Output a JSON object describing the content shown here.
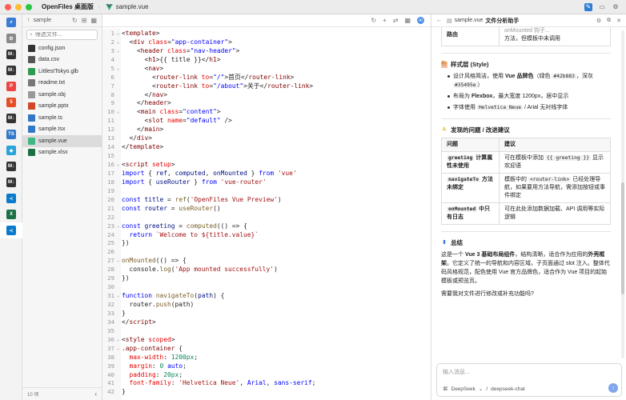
{
  "titlebar": {
    "app_name": "OpenFiles 桌面版",
    "separator": "·",
    "file_name": "sample.vue"
  },
  "sidebar": {
    "folder": "sample",
    "search_placeholder": "筛选文件...",
    "files": [
      {
        "name": "config.json",
        "icon": "github-icon",
        "color": "#333333"
      },
      {
        "name": "data.csv",
        "icon": "csv-icon",
        "color": "#555555"
      },
      {
        "name": "LittlestTokyo.glb",
        "icon": "3d-model-icon",
        "color": "#2e9b4e"
      },
      {
        "name": "readme.txt",
        "icon": "text-file-icon",
        "color": "#777777"
      },
      {
        "name": "sample.obj",
        "icon": "object-file-icon",
        "color": "#999999"
      },
      {
        "name": "sample.pptx",
        "icon": "powerpoint-icon",
        "color": "#d24726"
      },
      {
        "name": "sample.ts",
        "icon": "typescript-icon",
        "color": "#3178c6"
      },
      {
        "name": "sample.tsx",
        "icon": "typescript-icon",
        "color": "#3178c6"
      },
      {
        "name": "sample.vue",
        "icon": "vue-icon",
        "color": "#41b883",
        "selected": true
      },
      {
        "name": "sample.xlsx",
        "icon": "excel-icon",
        "color": "#1d7044"
      }
    ],
    "footer_count": "10 项"
  },
  "editor": {
    "lines": [
      [
        [
          "c-plain",
          "<"
        ],
        [
          "c-tag",
          "template"
        ],
        [
          "c-plain",
          ">"
        ]
      ],
      [
        [
          "c-plain",
          "  <"
        ],
        [
          "c-tag",
          "div"
        ],
        [
          "c-plain",
          " "
        ],
        [
          "c-attr",
          "class"
        ],
        [
          "c-plain",
          "="
        ],
        [
          "c-str",
          "\"app-container\""
        ],
        [
          "c-plain",
          ">"
        ]
      ],
      [
        [
          "c-plain",
          "    <"
        ],
        [
          "c-tag",
          "header"
        ],
        [
          "c-plain",
          " "
        ],
        [
          "c-attr",
          "class"
        ],
        [
          "c-plain",
          "="
        ],
        [
          "c-str",
          "\"nav-header\""
        ],
        [
          "c-plain",
          ">"
        ]
      ],
      [
        [
          "c-plain",
          "      <"
        ],
        [
          "c-tag",
          "h1"
        ],
        [
          "c-plain",
          ">{{ title }}</"
        ],
        [
          "c-tag",
          "h1"
        ],
        [
          "c-plain",
          ">"
        ]
      ],
      [
        [
          "c-plain",
          "      <"
        ],
        [
          "c-tag",
          "nav"
        ],
        [
          "c-plain",
          ">"
        ]
      ],
      [
        [
          "c-plain",
          "        <"
        ],
        [
          "c-tag",
          "router-link"
        ],
        [
          "c-plain",
          " "
        ],
        [
          "c-attr",
          "to"
        ],
        [
          "c-plain",
          "="
        ],
        [
          "c-str",
          "\"/\""
        ],
        [
          "c-plain",
          ">首页</"
        ],
        [
          "c-tag",
          "router-link"
        ],
        [
          "c-plain",
          ">"
        ]
      ],
      [
        [
          "c-plain",
          "        <"
        ],
        [
          "c-tag",
          "router-link"
        ],
        [
          "c-plain",
          " "
        ],
        [
          "c-attr",
          "to"
        ],
        [
          "c-plain",
          "="
        ],
        [
          "c-str",
          "\"/about\""
        ],
        [
          "c-plain",
          ">关于</"
        ],
        [
          "c-tag",
          "router-link"
        ],
        [
          "c-plain",
          ">"
        ]
      ],
      [
        [
          "c-plain",
          "      </"
        ],
        [
          "c-tag",
          "nav"
        ],
        [
          "c-plain",
          ">"
        ]
      ],
      [
        [
          "c-plain",
          "    </"
        ],
        [
          "c-tag",
          "header"
        ],
        [
          "c-plain",
          ">"
        ]
      ],
      [
        [
          "c-plain",
          "    <"
        ],
        [
          "c-tag",
          "main"
        ],
        [
          "c-plain",
          " "
        ],
        [
          "c-attr",
          "class"
        ],
        [
          "c-plain",
          "="
        ],
        [
          "c-str",
          "\"content\""
        ],
        [
          "c-plain",
          ">"
        ]
      ],
      [
        [
          "c-plain",
          "      <"
        ],
        [
          "c-tag",
          "slot"
        ],
        [
          "c-plain",
          " "
        ],
        [
          "c-attr",
          "name"
        ],
        [
          "c-plain",
          "="
        ],
        [
          "c-str",
          "\"default\""
        ],
        [
          "c-plain",
          " />"
        ]
      ],
      [
        [
          "c-plain",
          "    </"
        ],
        [
          "c-tag",
          "main"
        ],
        [
          "c-plain",
          ">"
        ]
      ],
      [
        [
          "c-plain",
          "  </"
        ],
        [
          "c-tag",
          "div"
        ],
        [
          "c-plain",
          ">"
        ]
      ],
      [
        [
          "c-plain",
          "</"
        ],
        [
          "c-tag",
          "template"
        ],
        [
          "c-plain",
          ">"
        ]
      ],
      [],
      [
        [
          "c-plain",
          "<"
        ],
        [
          "c-tag",
          "script"
        ],
        [
          "c-plain",
          " "
        ],
        [
          "c-attr",
          "setup"
        ],
        [
          "c-plain",
          ">"
        ]
      ],
      [
        [
          "c-kw",
          "import"
        ],
        [
          "c-plain",
          " { "
        ],
        [
          "c-var",
          "ref"
        ],
        [
          "c-plain",
          ", "
        ],
        [
          "c-var",
          "computed"
        ],
        [
          "c-plain",
          ", "
        ],
        [
          "c-var",
          "onMounted"
        ],
        [
          "c-plain",
          " } "
        ],
        [
          "c-kw",
          "from"
        ],
        [
          "c-plain",
          " "
        ],
        [
          "c-sstr",
          "'vue'"
        ]
      ],
      [
        [
          "c-kw",
          "import"
        ],
        [
          "c-plain",
          " { "
        ],
        [
          "c-var",
          "useRouter"
        ],
        [
          "c-plain",
          " } "
        ],
        [
          "c-kw",
          "from"
        ],
        [
          "c-plain",
          " "
        ],
        [
          "c-sstr",
          "'vue-router'"
        ]
      ],
      [],
      [
        [
          "c-kw",
          "const"
        ],
        [
          "c-plain",
          " "
        ],
        [
          "c-var",
          "title"
        ],
        [
          "c-plain",
          " = "
        ],
        [
          "c-fn",
          "ref"
        ],
        [
          "c-plain",
          "("
        ],
        [
          "c-sstr",
          "'OpenFiles Vue Preview'"
        ],
        [
          "c-plain",
          ")"
        ]
      ],
      [
        [
          "c-kw",
          "const"
        ],
        [
          "c-plain",
          " "
        ],
        [
          "c-var",
          "router"
        ],
        [
          "c-plain",
          " = "
        ],
        [
          "c-fn",
          "useRouter"
        ],
        [
          "c-plain",
          "()"
        ]
      ],
      [],
      [
        [
          "c-kw",
          "const"
        ],
        [
          "c-plain",
          " "
        ],
        [
          "c-var",
          "greeting"
        ],
        [
          "c-plain",
          " = "
        ],
        [
          "c-fn",
          "computed"
        ],
        [
          "c-plain",
          "(() => {"
        ]
      ],
      [
        [
          "c-plain",
          "  "
        ],
        [
          "c-kw",
          "return"
        ],
        [
          "c-plain",
          " "
        ],
        [
          "c-sstr",
          "`Welcome to ${title.value}`"
        ]
      ],
      [
        [
          "c-plain",
          "})"
        ]
      ],
      [],
      [
        [
          "c-fn",
          "onMounted"
        ],
        [
          "c-plain",
          "(() => {"
        ]
      ],
      [
        [
          "c-plain",
          "  console."
        ],
        [
          "c-fn",
          "log"
        ],
        [
          "c-plain",
          "("
        ],
        [
          "c-sstr",
          "'App mounted successfully'"
        ],
        [
          "c-plain",
          ")"
        ]
      ],
      [
        [
          "c-plain",
          "})"
        ]
      ],
      [],
      [
        [
          "c-kw",
          "function"
        ],
        [
          "c-plain",
          " "
        ],
        [
          "c-fn",
          "navigateTo"
        ],
        [
          "c-plain",
          "("
        ],
        [
          "c-var",
          "path"
        ],
        [
          "c-plain",
          ") {"
        ]
      ],
      [
        [
          "c-plain",
          "  router."
        ],
        [
          "c-fn",
          "push"
        ],
        [
          "c-plain",
          "(path)"
        ]
      ],
      [
        [
          "c-plain",
          "}"
        ]
      ],
      [
        [
          "c-plain",
          "</"
        ],
        [
          "c-tag",
          "script"
        ],
        [
          "c-plain",
          ">"
        ]
      ],
      [],
      [
        [
          "c-plain",
          "<"
        ],
        [
          "c-tag",
          "style"
        ],
        [
          "c-plain",
          " "
        ],
        [
          "c-attr",
          "scoped"
        ],
        [
          "c-plain",
          ">"
        ]
      ],
      [
        [
          "c-tag",
          ".app-container"
        ],
        [
          "c-plain",
          " {"
        ]
      ],
      [
        [
          "c-plain",
          "  "
        ],
        [
          "c-attr",
          "max-width"
        ],
        [
          "c-plain",
          ": "
        ],
        [
          "c-num",
          "1200px"
        ],
        [
          "c-plain",
          ";"
        ]
      ],
      [
        [
          "c-plain",
          "  "
        ],
        [
          "c-attr",
          "margin"
        ],
        [
          "c-plain",
          ": "
        ],
        [
          "c-num",
          "0"
        ],
        [
          "c-plain",
          " "
        ],
        [
          "c-str",
          "auto"
        ],
        [
          "c-plain",
          ";"
        ]
      ],
      [
        [
          "c-plain",
          "  "
        ],
        [
          "c-attr",
          "padding"
        ],
        [
          "c-plain",
          ": "
        ],
        [
          "c-num",
          "20px"
        ],
        [
          "c-plain",
          ";"
        ]
      ],
      [
        [
          "c-plain",
          "  "
        ],
        [
          "c-attr",
          "font-family"
        ],
        [
          "c-plain",
          ": "
        ],
        [
          "c-sstr",
          "'Helvetica Neue'"
        ],
        [
          "c-plain",
          ", "
        ],
        [
          "c-str",
          "Arial"
        ],
        [
          "c-plain",
          ", "
        ],
        [
          "c-str",
          "sans-serif"
        ],
        [
          "c-plain",
          ";"
        ]
      ],
      [
        [
          "c-plain",
          "}"
        ]
      ]
    ],
    "fold_lines": [
      1,
      2,
      3,
      5,
      10,
      16,
      23,
      27,
      31,
      36,
      37
    ]
  },
  "panel": {
    "file_name": "sample.vue",
    "title": "文件分析助手",
    "top_table": {
      "key": "路由",
      "value_line1": "onMounted 钩子...",
      "value_line2": "方法，但模板中未调用"
    },
    "style_heading": "样式层 (Style)",
    "style_items": [
      {
        "pre": "设计风格简洁，使用 ",
        "bold": "Vue 品牌色",
        "mid": "（绿色 ",
        "code1": "#42b883",
        "mid2": "，深灰 ",
        "code2": "#35495e",
        "post": "）"
      },
      {
        "pre": "布局为 ",
        "bold": "Flexbox",
        "post": "，最大宽度 1200px，居中显示"
      },
      {
        "pre": "字体使用 ",
        "code1": "Helvetica Neue",
        "post": " / Arial 无衬线字体"
      }
    ],
    "issues_heading": "发现的问题 / 改进建议",
    "issues_headers": [
      "问题",
      "建议"
    ],
    "issues_rows": [
      {
        "code": "greeting",
        "title": " 计算属性未使用",
        "sugg_pre": "可在模板中添加 ",
        "sugg_code": "{{ greeting }}",
        "sugg_post": " 显示欢迎语"
      },
      {
        "code": "navigateTo",
        "title": " 方法未绑定",
        "sugg_pre": "模板中的 ",
        "sugg_code": "<router-link>",
        "sugg_post": " 已经处理导航，如果要用方法导航，需添加按钮或事件绑定"
      },
      {
        "code": "onMounted",
        "title": " 中只有日志",
        "sugg_pre": "可在此处添加数据加载、API 调用等实际逻辑",
        "sugg_code": "",
        "sugg_post": ""
      }
    ],
    "summary_heading": "总结",
    "summary_pre": "这是一个 ",
    "summary_bold1": "Vue 3 基础布局组件",
    "summary_mid": "，结构清晰，适合作为应用的",
    "summary_bold2": "外壳框架",
    "summary_post": "。它定义了统一的导航和内容区域，子页面通过 slot 注入。整体代码风格规范，配色使用 Vue 官方品牌色，适合作为 Vue 项目的起始模板或预览页。",
    "question": "需要我对文件进行修改或补充功能吗?",
    "input_placeholder": "输入消息...",
    "model_name": "DeepSeek",
    "model_sep": "/",
    "model_id": "deepseek-chat",
    "send_label": "↑"
  }
}
